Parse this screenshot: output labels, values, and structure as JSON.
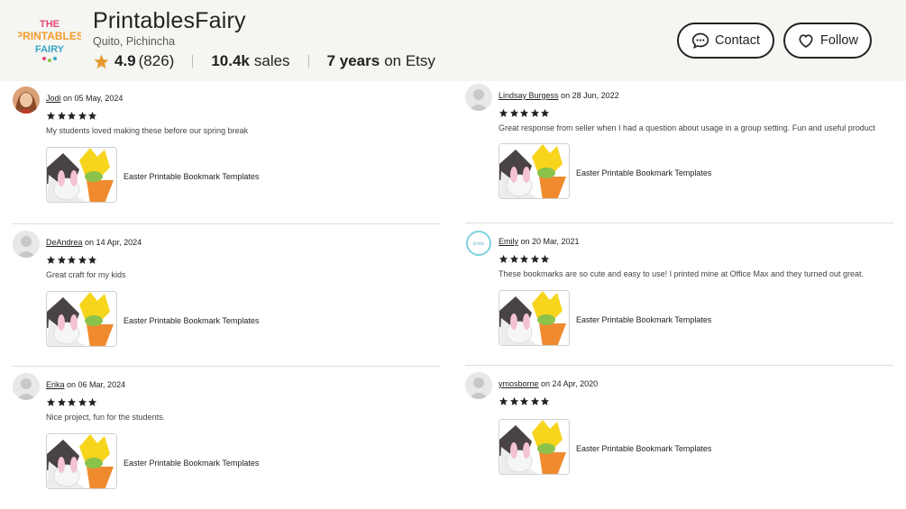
{
  "shop": {
    "name": "PrintablesFairy",
    "location": "Quito, Pichincha",
    "rating": "4.9",
    "rating_count": "(826)",
    "sales_num": "10.4k",
    "sales_word": "sales",
    "years_num": "7 years",
    "years_word": "on Etsy",
    "logo_text": "THE PRINTABLES FAIRY"
  },
  "actions": {
    "contact_label": "Contact",
    "follow_label": "Follow"
  },
  "colors": {
    "star": "#222222",
    "rating_star": "#e59b31",
    "header_bg": "#f5f5f1"
  },
  "reviews": [
    {
      "user": "Jodi",
      "date": "on 05 May, 2024",
      "text": "My students loved making these before our spring break",
      "product": "Easter Printable Bookmark Templates",
      "stars": 5
    },
    {
      "user": "Lindsay Burgess",
      "date": "on 28 Jun, 2022",
      "text": "Great response from seller when I had a question about usage in a group setting. Fun and useful product",
      "product": "Easter Printable Bookmark Templates",
      "stars": 5
    },
    {
      "user": "DeAndrea",
      "date": "on 14 Apr, 2024",
      "text": "Great craft for my kids",
      "product": "Easter Printable Bookmark Templates",
      "stars": 5
    },
    {
      "user": "Emily",
      "date": "on 20 Mar, 2021",
      "text": "These bookmarks are so cute and easy to use! I printed mine at Office Max and they turned out great.",
      "product": "Easter Printable Bookmark Templates",
      "stars": 5
    },
    {
      "user": "Erika",
      "date": "on 06 Mar, 2024",
      "text": "Nice project, fun for the students.",
      "product": "Easter Printable Bookmark Templates",
      "stars": 5
    },
    {
      "user": "ymosborne",
      "date": "on 24 Apr, 2020",
      "text": "",
      "product": "Easter Printable Bookmark Templates",
      "stars": 5
    }
  ]
}
